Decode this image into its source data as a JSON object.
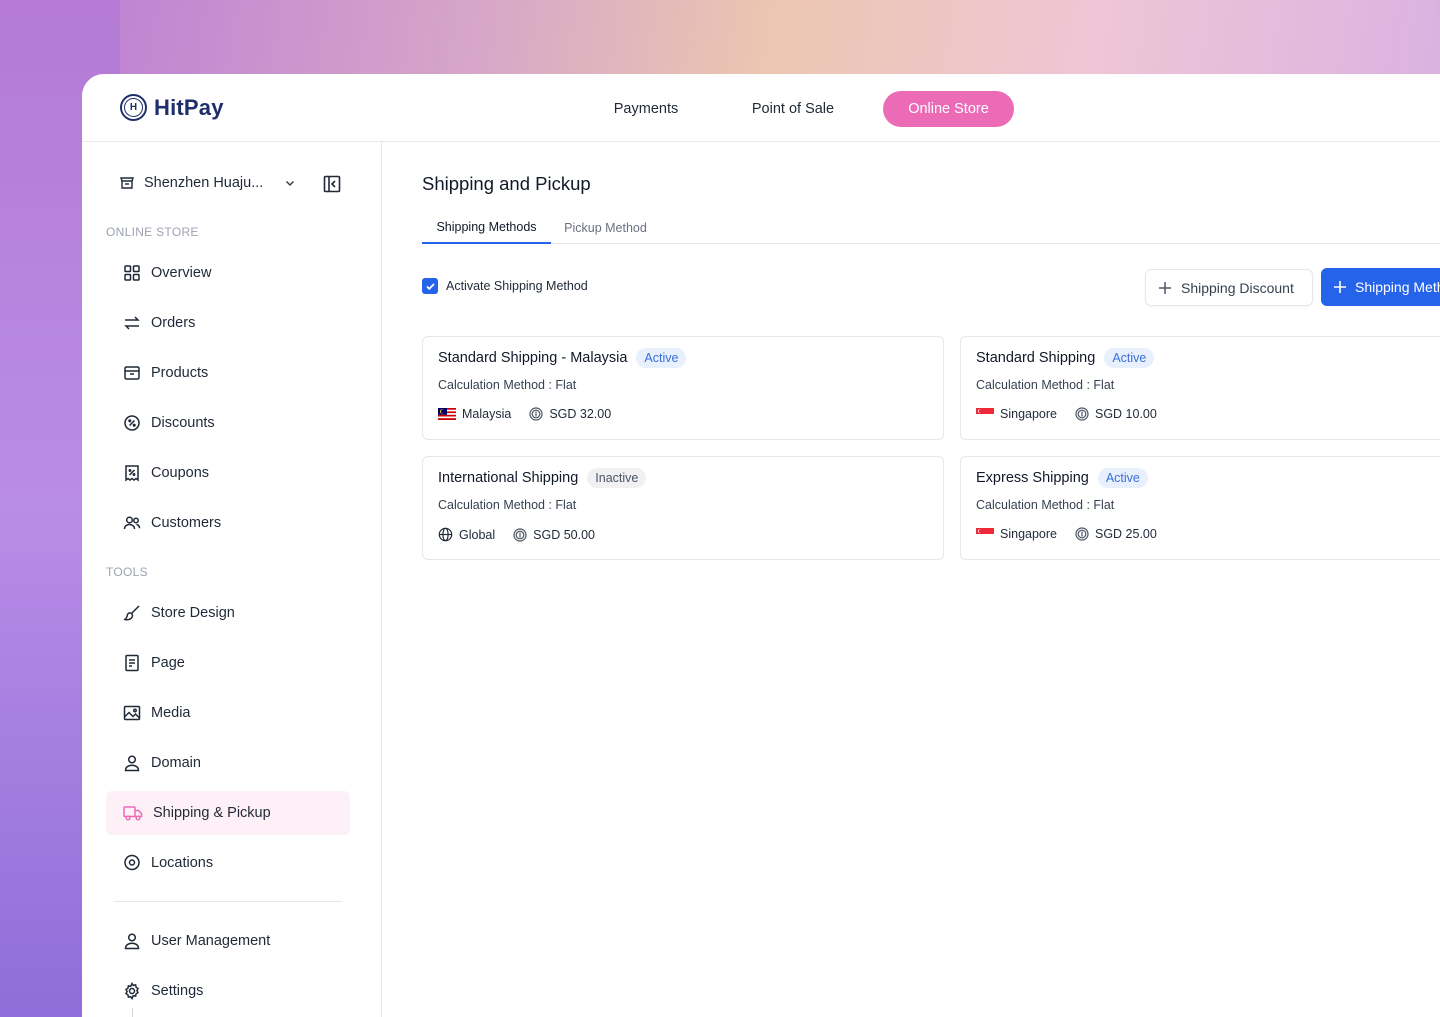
{
  "brand": {
    "name": "HitPay",
    "logo_letter": "H"
  },
  "topnav": [
    {
      "label": "Payments",
      "active": false
    },
    {
      "label": "Point of Sale",
      "active": false
    },
    {
      "label": "Online Store",
      "active": true
    }
  ],
  "colors": {
    "accent_pink": "#eb6bb7",
    "primary_blue": "#2563eb",
    "brand_navy": "#1e2f6b"
  },
  "sidebar": {
    "store_name": "Shenzhen Huaju...",
    "section_online": "ONLINE STORE",
    "online_items": [
      {
        "label": "Overview",
        "icon": "grid-icon"
      },
      {
        "label": "Orders",
        "icon": "swap-arrows-icon"
      },
      {
        "label": "Products",
        "icon": "box-icon"
      },
      {
        "label": "Discounts",
        "icon": "percent-badge-icon"
      },
      {
        "label": "Coupons",
        "icon": "coupon-icon"
      },
      {
        "label": "Customers",
        "icon": "users-icon"
      }
    ],
    "section_tools": "TOOLS",
    "tool_items": [
      {
        "label": "Store Design",
        "icon": "brush-icon"
      },
      {
        "label": "Page",
        "icon": "page-icon"
      },
      {
        "label": "Media",
        "icon": "image-icon"
      },
      {
        "label": "Domain",
        "icon": "user-icon"
      },
      {
        "label": "Shipping & Pickup",
        "icon": "truck-icon",
        "active": true
      },
      {
        "label": "Locations",
        "icon": "location-pin-icon"
      }
    ],
    "bottom_items": [
      {
        "label": "User Management",
        "icon": "user-icon"
      },
      {
        "label": "Settings",
        "icon": "gear-icon"
      }
    ]
  },
  "main": {
    "title": "Shipping and Pickup",
    "tabs": [
      {
        "label": "Shipping Methods",
        "active": true
      },
      {
        "label": "Pickup Method",
        "active": false
      }
    ],
    "activate_label": "Activate Shipping Method",
    "activate_checked": true,
    "discount_button": "Shipping Discount",
    "add_button": "Shipping Method",
    "cards": [
      {
        "title": "Standard Shipping - Malaysia",
        "status": "Active",
        "method": "Calculation Method : Flat",
        "region": "Malaysia",
        "region_icon": "malaysia-flag-icon",
        "price": "SGD 32.00"
      },
      {
        "title": "Standard Shipping",
        "status": "Active",
        "method": "Calculation Method : Flat",
        "region": "Singapore",
        "region_icon": "singapore-flag-icon",
        "price": "SGD 10.00"
      },
      {
        "title": "International Shipping",
        "status": "Inactive",
        "method": "Calculation Method : Flat",
        "region": "Global",
        "region_icon": "globe-icon",
        "price": "SGD 50.00"
      },
      {
        "title": "Express Shipping",
        "status": "Active",
        "method": "Calculation Method : Flat",
        "region": "Singapore",
        "region_icon": "singapore-flag-icon",
        "price": "SGD 25.00"
      }
    ]
  }
}
